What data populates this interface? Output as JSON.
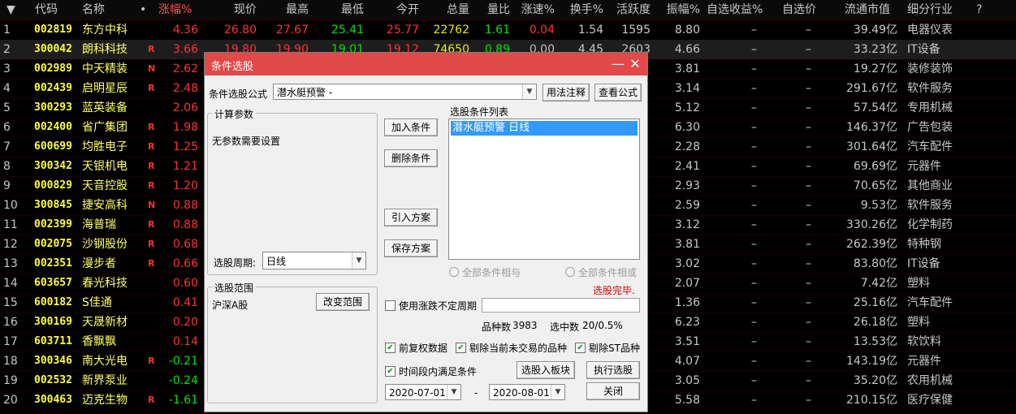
{
  "columns": {
    "arrow": "▼",
    "code": "代码",
    "name": "名称",
    "dot": "•",
    "change_pct": "涨幅%",
    "price": "现价",
    "high": "最高",
    "low": "最低",
    "open": "今开",
    "volume": "总量",
    "vol_ratio": "量比",
    "speed": "涨速%",
    "turnover": "换手%",
    "activity": "活跃度",
    "amplitude": "振幅%",
    "fav_return": "自选收益%",
    "fav_price": "自选价",
    "market_cap": "流通市值",
    "industry": "细分行业",
    "help": "?"
  },
  "rows": [
    {
      "idx": "1",
      "code": "002819",
      "name": "东方中科",
      "badge": "",
      "change": "4.36",
      "price": "26.80",
      "high": "27.67",
      "low": "25.41",
      "open": "25.77",
      "volume": "22762",
      "vol_ratio": "1.61",
      "speed": "0.04",
      "turnover": "1.54",
      "activity": "1595",
      "amplitude": "8.80",
      "fav_return": "–",
      "fav_price": "–",
      "cap": "39.49亿",
      "industry": "电器仪表"
    },
    {
      "idx": "2",
      "code": "300042",
      "name": "朗科科技",
      "badge": "R",
      "change": "3.66",
      "price": "19.80",
      "high": "19.90",
      "low": "19.01",
      "open": "19.12",
      "volume": "74650",
      "vol_ratio": "0.89",
      "speed": "0.00",
      "turnover": "4.45",
      "activity": "2603",
      "amplitude": "4.66",
      "fav_return": "–",
      "fav_price": "–",
      "cap": "33.23亿",
      "industry": "IT设备"
    },
    {
      "idx": "3",
      "code": "002989",
      "name": "中天精装",
      "badge": "N",
      "change": "2.62",
      "amplitude": "3.81",
      "fav_return": "–",
      "fav_price": "–",
      "cap": "19.27亿",
      "industry": "装修装饰"
    },
    {
      "idx": "4",
      "code": "002439",
      "name": "启明星辰",
      "badge": "R",
      "change": "2.48",
      "amplitude": "3.14",
      "fav_return": "–",
      "fav_price": "–",
      "cap": "291.67亿",
      "industry": "软件服务"
    },
    {
      "idx": "5",
      "code": "300293",
      "name": "蓝英装备",
      "badge": "",
      "change": "2.06",
      "amplitude": "5.12",
      "fav_return": "–",
      "fav_price": "–",
      "cap": "57.54亿",
      "industry": "专用机械"
    },
    {
      "idx": "6",
      "code": "002400",
      "name": "省广集团",
      "badge": "R",
      "change": "1.98",
      "amplitude": "6.30",
      "fav_return": "–",
      "fav_price": "–",
      "cap": "146.37亿",
      "industry": "广告包装"
    },
    {
      "idx": "7",
      "code": "600699",
      "name": "均胜电子",
      "badge": "R",
      "change": "1.25",
      "amplitude": "2.28",
      "fav_return": "–",
      "fav_price": "–",
      "cap": "301.64亿",
      "industry": "汽车配件"
    },
    {
      "idx": "8",
      "code": "300342",
      "name": "天银机电",
      "badge": "R",
      "change": "1.21",
      "amplitude": "2.41",
      "fav_return": "–",
      "fav_price": "–",
      "cap": "69.69亿",
      "industry": "元器件"
    },
    {
      "idx": "9",
      "code": "000829",
      "name": "天音控股",
      "badge": "R",
      "change": "1.20",
      "amplitude": "2.93",
      "fav_return": "–",
      "fav_price": "–",
      "cap": "70.65亿",
      "industry": "其他商业"
    },
    {
      "idx": "10",
      "code": "300845",
      "name": "捷安高科",
      "badge": "N",
      "change": "0.88",
      "amplitude": "2.59",
      "fav_return": "–",
      "fav_price": "–",
      "cap": "9.53亿",
      "industry": "软件服务"
    },
    {
      "idx": "11",
      "code": "002399",
      "name": "海普瑞",
      "badge": "R",
      "change": "0.88",
      "amplitude": "3.12",
      "fav_return": "–",
      "fav_price": "–",
      "cap": "330.26亿",
      "industry": "化学制药"
    },
    {
      "idx": "12",
      "code": "002075",
      "name": "沙钢股份",
      "badge": "R",
      "change": "0.68",
      "amplitude": "3.81",
      "fav_return": "–",
      "fav_price": "–",
      "cap": "262.39亿",
      "industry": "特种钢"
    },
    {
      "idx": "13",
      "code": "002351",
      "name": "漫步者",
      "badge": "R",
      "change": "0.66",
      "amplitude": "3.02",
      "fav_return": "–",
      "fav_price": "–",
      "cap": "83.80亿",
      "industry": "IT设备"
    },
    {
      "idx": "14",
      "code": "603657",
      "name": "春光科技",
      "badge": "",
      "change": "0.60",
      "amplitude": "2.07",
      "fav_return": "–",
      "fav_price": "–",
      "cap": "7.42亿",
      "industry": "塑料"
    },
    {
      "idx": "15",
      "code": "600182",
      "name": "S佳通",
      "badge": "",
      "change": "0.41",
      "amplitude": "1.36",
      "fav_return": "–",
      "fav_price": "–",
      "cap": "25.16亿",
      "industry": "汽车配件"
    },
    {
      "idx": "16",
      "code": "300169",
      "name": "天晟新材",
      "badge": "",
      "change": "0.20",
      "amplitude": "6.23",
      "fav_return": "–",
      "fav_price": "–",
      "cap": "26.18亿",
      "industry": "塑料"
    },
    {
      "idx": "17",
      "code": "603711",
      "name": "香飘飘",
      "badge": "",
      "change": "0.14",
      "amplitude": "3.51",
      "fav_return": "–",
      "fav_price": "–",
      "cap": "13.53亿",
      "industry": "软饮料"
    },
    {
      "idx": "18",
      "code": "300346",
      "name": "南大光电",
      "badge": "R",
      "change": "-0.21",
      "amplitude": "4.07",
      "fav_return": "–",
      "fav_price": "–",
      "cap": "143.19亿",
      "industry": "元器件"
    },
    {
      "idx": "19",
      "code": "002532",
      "name": "新界泵业",
      "badge": "",
      "change": "-0.24",
      "amplitude": "3.05",
      "fav_return": "–",
      "fav_price": "–",
      "cap": "35.20亿",
      "industry": "农用机械"
    },
    {
      "idx": "20",
      "code": "300463",
      "name": "迈克生物",
      "badge": "R",
      "change": "-1.61",
      "amplitude": "5.58",
      "fav_return": "–",
      "fav_price": "–",
      "cap": "210.15亿",
      "industry": "医疗保健"
    }
  ],
  "dialog": {
    "title": "条件选股",
    "minimize": "—",
    "close": "✕",
    "formula_label": "条件选股公式",
    "formula_value": "潜水艇预警  -",
    "usage_btn": "用法注释",
    "view_btn": "查看公式",
    "params_title": "计算参数",
    "params_text": "无参数需要设置",
    "period_label": "选股周期:",
    "period_value": "日线",
    "add_btn": "加入条件",
    "delete_btn": "删除条件",
    "import_btn": "引入方案",
    "save_btn": "保存方案",
    "cond_list_title": "选股条件列表",
    "cond_items": [
      "潜水艇预警  日线"
    ],
    "radio_and": "全部条件相与",
    "radio_or": "全部条件相或",
    "status": "选股完毕.",
    "scope_title": "选股范围",
    "scope_value": "沪深A股",
    "change_scope_btn": "改变范围",
    "use_period_label": "使用涨跌不定周期",
    "count_label": "品种数",
    "count_value": "3983",
    "selected_label": "选中数",
    "selected_value": "20/0.5%",
    "chk_adjust": "前复权数据",
    "chk_exclude_halt": "剔除当前未交易的品种",
    "chk_exclude_st": "剔除ST品种",
    "chk_period": "时间段内满足条件",
    "to_block_btn": "选股入板块",
    "execute_btn": "执行选股",
    "date_from": "2020-07-01",
    "date_sep": "-",
    "date_to": "2020-08-01",
    "close_btn": "关闭"
  },
  "colors": {
    "header_bg": "#e24949",
    "up": "#ff3232",
    "down": "#00e600",
    "code": "#ffff33"
  }
}
